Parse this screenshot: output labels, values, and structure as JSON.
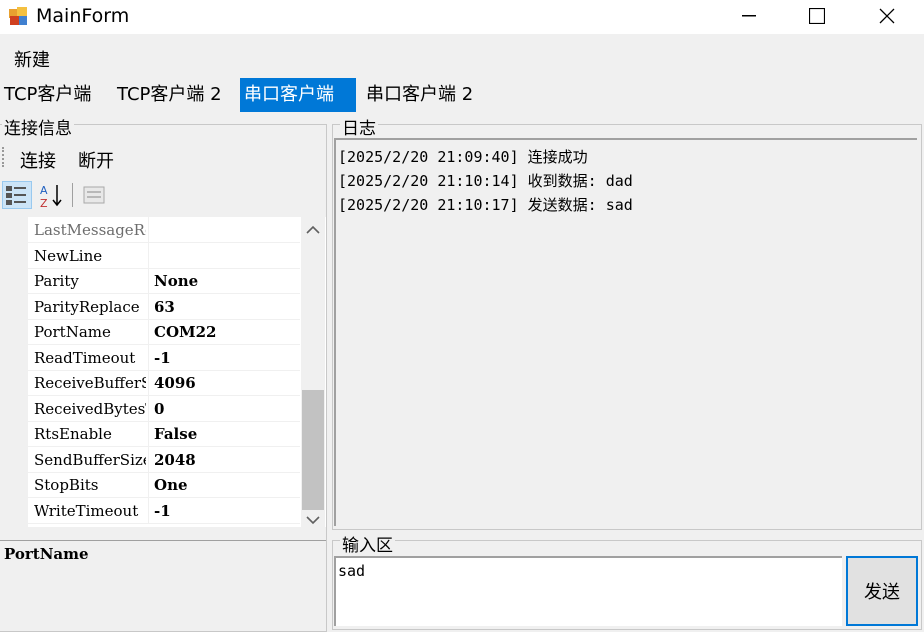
{
  "window": {
    "title": "MainForm",
    "minimize": "—",
    "maximize": "☐",
    "close": "✕"
  },
  "menu": {
    "new": "新建"
  },
  "tabs": [
    "TCP客户端",
    "TCP客户端 2",
    "串口客户端",
    "串口客户端 2"
  ],
  "left": {
    "group_title": "连接信息",
    "connect": "连接",
    "disconnect": "断开",
    "properties": [
      {
        "name": "LastMessageReceived",
        "value": ""
      },
      {
        "name": "NewLine",
        "value": ""
      },
      {
        "name": "Parity",
        "value": "None"
      },
      {
        "name": "ParityReplace",
        "value": "63"
      },
      {
        "name": "PortName",
        "value": "COM22"
      },
      {
        "name": "ReadTimeout",
        "value": "-1"
      },
      {
        "name": "ReceiveBufferSize",
        "value": "4096"
      },
      {
        "name": "ReceivedBytesThreshold",
        "value": "0"
      },
      {
        "name": "RtsEnable",
        "value": "False"
      },
      {
        "name": "SendBufferSize",
        "value": "2048"
      },
      {
        "name": "StopBits",
        "value": "One"
      },
      {
        "name": "WriteTimeout",
        "value": "-1"
      }
    ],
    "description_title": "PortName"
  },
  "log": {
    "group_title": "日志",
    "lines": [
      "[2025/2/20 21:09:40] 连接成功",
      "[2025/2/20 21:10:14] 收到数据: dad",
      "[2025/2/20 21:10:17] 发送数据: sad"
    ]
  },
  "input": {
    "group_title": "输入区",
    "value": "sad",
    "send": "发送"
  }
}
